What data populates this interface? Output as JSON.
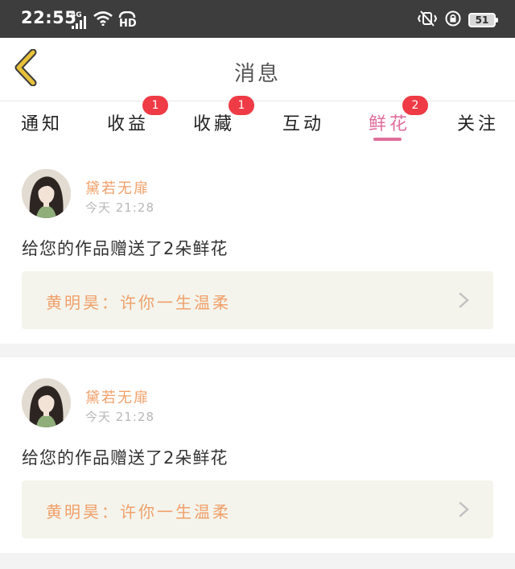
{
  "status_bar": {
    "time": "22:55",
    "network": "4G",
    "hd": "HD",
    "battery": "51"
  },
  "header": {
    "title": "消息"
  },
  "tabs": [
    {
      "label": "通知",
      "badge": ""
    },
    {
      "label": "收益",
      "badge": "1"
    },
    {
      "label": "收藏",
      "badge": "1"
    },
    {
      "label": "互动",
      "badge": ""
    },
    {
      "label": "鲜花",
      "badge": "2",
      "active": true
    },
    {
      "label": "关注",
      "badge": ""
    }
  ],
  "messages": [
    {
      "user": "黛若无扉",
      "time": "今天 21:28",
      "text": "给您的作品赠送了2朵鲜花",
      "quote": "黄明昊：许你一生温柔"
    },
    {
      "user": "黛若无扉",
      "time": "今天 21:28",
      "text": "给您的作品赠送了2朵鲜花",
      "quote": "黄明昊：许你一生温柔"
    }
  ],
  "colors": {
    "accent": "#e06e9c",
    "badge": "#ee3b45",
    "username": "#f0a06a",
    "quote_bg": "#f4f4ec",
    "back_arrow": "#e8c13a"
  },
  "icons": [
    "back-arrow-icon",
    "chevron-right-icon",
    "signal-icon",
    "wifi-icon",
    "hd-call-icon",
    "vibrate-icon",
    "lock-rotation-icon",
    "battery-icon"
  ]
}
